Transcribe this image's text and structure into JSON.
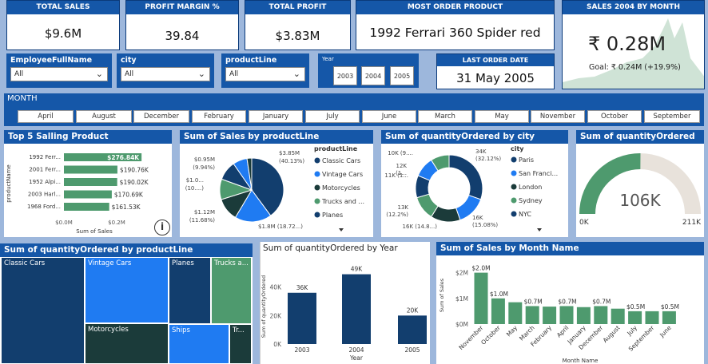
{
  "kpis": {
    "total_sales": {
      "label": "TOTAL SALES",
      "value": "$9.6M"
    },
    "profit_margin": {
      "label": "PROFIT MARGIN %",
      "value": "39.84"
    },
    "total_profit": {
      "label": "TOTAL PROFIT",
      "value": "$3.83M"
    },
    "most_order_product": {
      "label": "MOST ORDER PRODUCT",
      "value": "1992 Ferrari 360 Spider red"
    },
    "sales_2004": {
      "label": "SALES 2004 BY MONTH",
      "value": "₹ 0.28M",
      "goal": "Goal: ₹ 0.24M (+19.9%)"
    }
  },
  "slicers": {
    "employee": {
      "label": "EmployeeFullName",
      "value": "All"
    },
    "city": {
      "label": "city",
      "value": "All"
    },
    "productline": {
      "label": "productLine",
      "value": "All"
    },
    "year": {
      "label": "Year",
      "options": [
        "2003",
        "2004",
        "2005"
      ]
    },
    "last_order": {
      "label": "LAST ORDER DATE",
      "value": "31 May 2005"
    }
  },
  "month_slicer": {
    "label": "MONTH",
    "options": [
      "April",
      "August",
      "December",
      "February",
      "January",
      "July",
      "June",
      "March",
      "May",
      "November",
      "October",
      "September"
    ]
  },
  "colors": {
    "dark": "#123e6e",
    "blue": "#1f7bf2",
    "green": "#4e9a6e",
    "darkgreen": "#1b3b3a",
    "header": "#1557a8",
    "gauge_bg": "#e8e2db"
  },
  "top5": {
    "title": "Top 5 Salling Product",
    "ylabel": "productName",
    "xlabel": "Sum of Sales",
    "ticks": [
      "$0.0M",
      "$0.2M"
    ],
    "info_icon": "info-icon"
  },
  "pie_line": {
    "title": "Sum of Sales by productLine",
    "legend_title": "productLine",
    "legend": [
      "Classic Cars",
      "Vintage Cars",
      "Motorcycles",
      "Trucks and ...",
      "Planes"
    ]
  },
  "donut_city": {
    "title": "Sum of quantityOrdered by city",
    "legend_title": "city",
    "legend": [
      "Paris",
      "San Franci...",
      "London",
      "Sydney",
      "NYC"
    ]
  },
  "gauge": {
    "title": "Sum of quantityOrdered",
    "value": "106K",
    "min": "0K",
    "max": "211K",
    "fraction": 0.502
  },
  "treemap": {
    "title": "Sum of quantityOrdered by productLine",
    "tiles": [
      "Classic Cars",
      "Vintage Cars",
      "Motorcycles",
      "Planes",
      "Trucks a...",
      "Ships",
      "Tr..."
    ]
  },
  "year_chart": {
    "title": "Sum of quantityOrdered by Year",
    "ylabel": "Sum of quantityOrdered",
    "xlabel": "Year",
    "ticks": [
      "0K",
      "20K",
      "40K"
    ]
  },
  "month_chart": {
    "title": "Sum of Sales by Month Name",
    "ylabel": "Sum of Sales",
    "xlabel": "Month Name",
    "ticks": [
      "$0M",
      "$1M",
      "$2M"
    ]
  },
  "chart_data": [
    {
      "type": "bar",
      "orientation": "horizontal",
      "title": "Top 5 Salling Product",
      "categories": [
        "1992 Ferr...",
        "2001 Ferr...",
        "1952 Alpi...",
        "2003 Harl...",
        "1968 Ford..."
      ],
      "values": [
        276840,
        190760,
        190020,
        170690,
        161530
      ],
      "labels": [
        "$276.84K",
        "$190.76K",
        "$190.02K",
        "$170.69K",
        "$161.53K"
      ],
      "xlabel": "Sum of Sales",
      "ylabel": "productName",
      "xlim": [
        0,
        300000
      ]
    },
    {
      "type": "pie",
      "title": "Sum of Sales by productLine",
      "categories": [
        "Classic Cars",
        "Vintage Cars",
        "Motorcycles",
        "Trucks and ...",
        "Planes",
        "Ships",
        "Trains"
      ],
      "values": [
        3.85,
        1.8,
        1.12,
        1.0,
        0.95,
        0.7,
        0.23
      ],
      "labels": [
        "$3.85M (40.13%)",
        "$1.8M (18.72...)",
        "$1.12M (11.68%)",
        "$1.0... (10....)",
        "$0.95M (9.94%)",
        "",
        ""
      ]
    },
    {
      "type": "pie",
      "subtype": "donut",
      "title": "Sum of quantityOrdered by city",
      "categories": [
        "Paris",
        "San Franci...",
        "London",
        "Sydney",
        "NYC",
        "Other1",
        "Other2"
      ],
      "values": [
        34,
        16,
        16,
        13,
        12,
        11,
        10
      ],
      "labels": [
        "34K (32.12%)",
        "16K (15.08%)",
        "16K (14.8...)",
        "13K (12.2%)",
        "12K (1...)",
        "11K (1...)",
        "10K (9....)"
      ]
    },
    {
      "type": "bar",
      "title": "Sum of quantityOrdered by Year",
      "categories": [
        "2003",
        "2004",
        "2005"
      ],
      "values": [
        36,
        49,
        20
      ],
      "labels": [
        "36K",
        "49K",
        "20K"
      ],
      "xlabel": "Year",
      "ylabel": "Sum of quantityOrdered",
      "ylim": [
        0,
        50
      ]
    },
    {
      "type": "bar",
      "title": "Sum of Sales by Month Name",
      "categories": [
        "November",
        "October",
        "May",
        "March",
        "February",
        "April",
        "January",
        "December",
        "August",
        "July",
        "September",
        "June"
      ],
      "values": [
        2.0,
        1.0,
        0.85,
        0.7,
        0.68,
        0.7,
        0.66,
        0.7,
        0.6,
        0.5,
        0.5,
        0.5
      ],
      "labels": [
        "$2.0M",
        "$1.0M",
        "",
        "$0.7M",
        "",
        "$0.7M",
        "",
        "$0.7M",
        "",
        "$0.5M",
        "",
        "$0.5M"
      ],
      "xlabel": "Month Name",
      "ylabel": "Sum of Sales",
      "ylim": [
        0,
        2.2
      ]
    }
  ]
}
